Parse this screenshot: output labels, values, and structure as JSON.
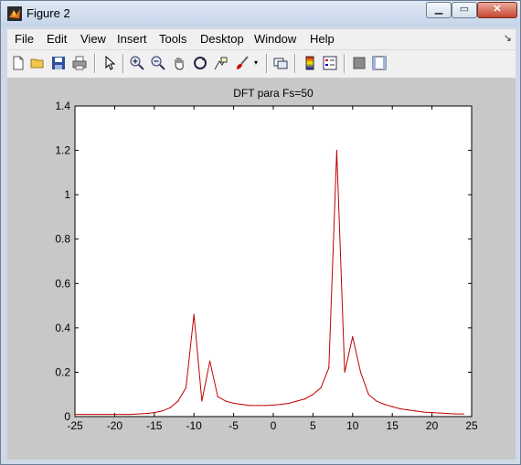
{
  "window": {
    "title": "Figure 2"
  },
  "menu": {
    "items": [
      "File",
      "Edit",
      "View",
      "Insert",
      "Tools",
      "Desktop",
      "Window",
      "Help"
    ]
  },
  "toolbar": {
    "icons": [
      "new-figure-icon",
      "open-file-icon",
      "save-icon",
      "print-icon",
      "edit-plot-arrow-icon",
      "zoom-in-icon",
      "zoom-out-icon",
      "pan-hand-icon",
      "rotate-3d-icon",
      "data-cursor-icon",
      "brush-icon",
      "brush-dropdown-icon",
      "link-plot-icon",
      "colorbar-icon",
      "legend-icon",
      "hide-plot-tools-icon",
      "show-plot-tools-icon"
    ]
  },
  "colors": {
    "line": "#c00000",
    "plot_bg": "#ffffff",
    "figure_bg": "#c8c8c8"
  },
  "chart_data": {
    "type": "line",
    "title": "DFT para Fs=50",
    "xlabel": "",
    "ylabel": "",
    "xlim": [
      -25,
      25
    ],
    "ylim": [
      0,
      1.4
    ],
    "xticks": [
      -25,
      -20,
      -15,
      -10,
      -5,
      0,
      5,
      10,
      15,
      20,
      25
    ],
    "yticks": [
      0,
      0.2,
      0.4,
      0.6,
      0.8,
      1,
      1.2,
      1.4
    ],
    "ytick_labels": [
      "0",
      "0.2",
      "0.4",
      "0.6",
      "0.8",
      "1",
      "1.2",
      "1.4"
    ],
    "grid": false,
    "series": [
      {
        "x": [
          -25,
          -24,
          -23,
          -22,
          -21,
          -20,
          -19,
          -18,
          -17,
          -16,
          -15,
          -14,
          -13,
          -12,
          -11,
          -10,
          -9,
          -8,
          -7,
          -6,
          -5,
          -4,
          -3,
          -2,
          -1,
          0,
          1,
          2,
          3,
          4,
          5,
          6,
          7,
          8,
          9,
          10,
          11,
          12,
          13,
          14,
          15,
          16,
          17,
          18,
          19,
          20,
          21,
          22,
          23,
          24
        ],
        "y": [
          0.01,
          0.01,
          0.01,
          0.01,
          0.01,
          0.01,
          0.01,
          0.01,
          0.012,
          0.014,
          0.018,
          0.025,
          0.04,
          0.07,
          0.13,
          0.46,
          0.07,
          0.25,
          0.09,
          0.07,
          0.06,
          0.055,
          0.05,
          0.05,
          0.05,
          0.052,
          0.055,
          0.06,
          0.07,
          0.08,
          0.1,
          0.13,
          0.22,
          1.2,
          0.2,
          0.36,
          0.2,
          0.1,
          0.07,
          0.055,
          0.045,
          0.035,
          0.03,
          0.025,
          0.02,
          0.018,
          0.016,
          0.014,
          0.012,
          0.012
        ]
      }
    ]
  }
}
